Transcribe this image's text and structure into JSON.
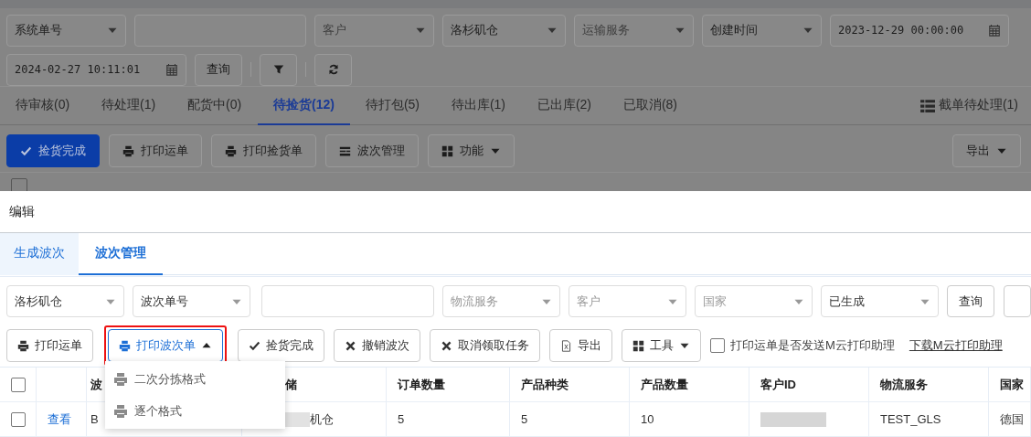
{
  "background_page": {
    "filters": [
      {
        "kind": "select",
        "value": "系统单号"
      },
      {
        "kind": "input"
      },
      {
        "kind": "select",
        "placeholder": "客户"
      },
      {
        "kind": "select",
        "value": "洛杉矶仓"
      },
      {
        "kind": "select",
        "placeholder": "运输服务"
      },
      {
        "kind": "select",
        "value": "创建时间"
      },
      {
        "kind": "date",
        "value": "2023-12-29 00:00:00"
      },
      {
        "kind": "date",
        "value": "2024-02-27 10:11:01"
      },
      {
        "kind": "button",
        "label": "查询"
      },
      {
        "kind": "filter"
      },
      {
        "kind": "refresh"
      }
    ],
    "tabs": [
      {
        "label": "待审核(0)",
        "selected": false
      },
      {
        "label": "待处理(1)",
        "selected": false
      },
      {
        "label": "配货中(0)",
        "selected": false
      },
      {
        "label": "待捡货(12)",
        "selected": true
      },
      {
        "label": "待打包(5)",
        "selected": false
      },
      {
        "label": "待出库(1)",
        "selected": false
      },
      {
        "label": "已出库(2)",
        "selected": false
      },
      {
        "label": "已取消(8)",
        "selected": false
      }
    ],
    "side_link": "截单待处理(1)",
    "toolbar": [
      {
        "kind": "primary",
        "label": "捡货完成"
      },
      {
        "kind": "default",
        "label": "打印运单"
      },
      {
        "kind": "default",
        "label": "打印捡货单"
      },
      {
        "kind": "default",
        "label": "波次管理"
      },
      {
        "kind": "dropdown",
        "label": "功能"
      }
    ],
    "export_button": "导出",
    "table_header_checked": false
  },
  "modal": {
    "title": "编辑",
    "tabs": [
      {
        "label": "生成波次",
        "selected": false
      },
      {
        "label": "波次管理",
        "selected": true
      }
    ],
    "filters": [
      {
        "kind": "select",
        "value": "洛杉矶仓"
      },
      {
        "kind": "select",
        "value": "波次单号"
      },
      {
        "kind": "input"
      },
      {
        "kind": "select",
        "placeholder": "物流服务"
      },
      {
        "kind": "select",
        "placeholder": "客户"
      },
      {
        "kind": "select",
        "placeholder": "国家"
      },
      {
        "kind": "select",
        "value": "已生成"
      },
      {
        "kind": "button",
        "label": "查询"
      },
      {
        "kind": "cut"
      }
    ],
    "toolbar": [
      {
        "kind": "default",
        "label": "打印运单",
        "open": false,
        "highlighted": false
      },
      {
        "kind": "dropdown",
        "label": "打印波次单",
        "open": true,
        "highlighted": true
      },
      {
        "kind": "default",
        "label": "捡货完成",
        "open": false,
        "highlighted": false
      },
      {
        "kind": "default",
        "label": "撤销波次",
        "open": false,
        "highlighted": false
      },
      {
        "kind": "default",
        "label": "取消领取任务",
        "open": false,
        "highlighted": false
      },
      {
        "kind": "default",
        "label": "导出",
        "open": false,
        "highlighted": false
      },
      {
        "kind": "dropdown",
        "label": "工具",
        "open": false,
        "highlighted": false
      }
    ],
    "send_checkbox": {
      "label": "打印运单是否发送M云打印助理",
      "checked": false
    },
    "download_link": "下载M云打印助理",
    "dropdown_menu": [
      "二次分拣格式",
      "逐个格式"
    ],
    "table": {
      "header_checked": false,
      "columns": [
        "",
        "波",
        "储",
        "订单数量",
        "产品种类",
        "产品数量",
        "客户ID",
        "物流服务",
        "国家"
      ],
      "rows": [
        {
          "checked": false,
          "cells": [
            {
              "kind": "link",
              "text": "查看"
            },
            {
              "kind": "text",
              "text": "B"
            },
            {
              "kind": "blurred",
              "text": "机仓"
            },
            {
              "kind": "text",
              "text": "5"
            },
            {
              "kind": "text",
              "text": "5"
            },
            {
              "kind": "text",
              "text": "10"
            },
            {
              "kind": "blurred"
            },
            {
              "kind": "text",
              "text": "TEST_GLS"
            },
            {
              "kind": "text",
              "text": "德国"
            }
          ]
        }
      ]
    }
  }
}
